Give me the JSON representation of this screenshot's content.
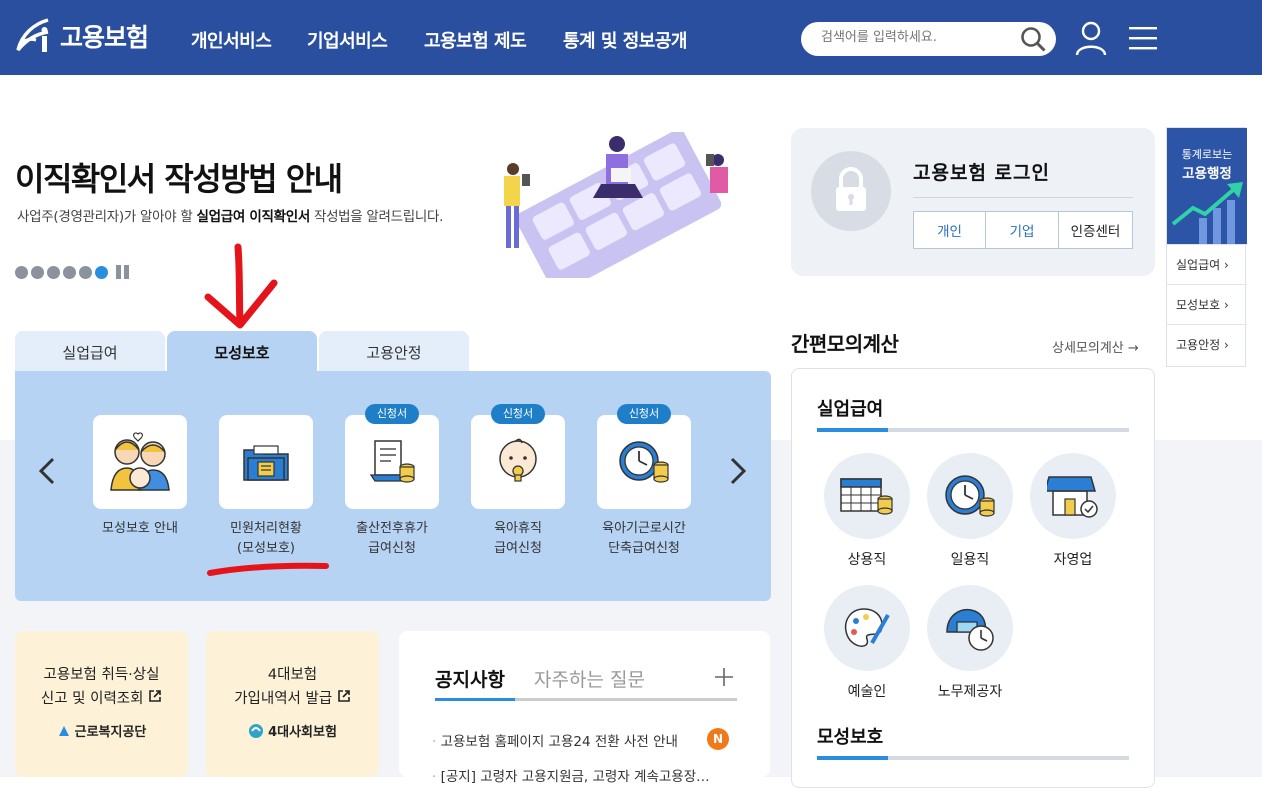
{
  "header": {
    "logo_text": "고용보험",
    "nav": [
      "개인서비스",
      "기업서비스",
      "고용보험 제도",
      "통계 및 정보공개"
    ],
    "search_placeholder": "검색어를 입력하세요."
  },
  "hero": {
    "title": "이직확인서 작성방법 안내",
    "subtitle_pre": "사업주(경영관리자)가 알아야 할 ",
    "subtitle_bold": "실업급여 이직확인서",
    "subtitle_post": " 작성법을 알려드립니다.",
    "slide_count": 6,
    "active_slide": 6
  },
  "tabs": [
    {
      "label": "실업급여",
      "active": false
    },
    {
      "label": "모성보호",
      "active": true
    },
    {
      "label": "고용안정",
      "active": false
    }
  ],
  "services": [
    {
      "line1": "모성보호 안내",
      "line2": "",
      "tag": "",
      "icon": "family-icon"
    },
    {
      "line1": "민원처리현황",
      "line2": "(모성보호)",
      "tag": "",
      "icon": "folder-document-icon"
    },
    {
      "line1": "출산전후휴가",
      "line2": "급여신청",
      "tag": "신청서",
      "icon": "document-coins-icon"
    },
    {
      "line1": "육아휴직",
      "line2": "급여신청",
      "tag": "신청서",
      "icon": "baby-icon"
    },
    {
      "line1": "육아기근로시간",
      "line2": "단축급여신청",
      "tag": "신청서",
      "icon": "clock-coins-icon"
    }
  ],
  "cards": [
    {
      "line1": "고용보험 취득·상실",
      "line2": "신고 및 이력조회",
      "org": "근로복지공단"
    },
    {
      "line1": "4대보험",
      "line2": "가입내역서 발급",
      "org": "4대사회보험"
    }
  ],
  "notice": {
    "tab_active": "공지사항",
    "tab_inactive": "자주하는 질문",
    "items": [
      {
        "text": "고용보험 홈페이지 고용24 전환 사전 안내",
        "badge": "N"
      },
      {
        "text": "[공지] 고령자 고용지원금, 고령자 계속고용장…",
        "badge": ""
      }
    ]
  },
  "login": {
    "title": "고용보험 로그인",
    "buttons": [
      "개인",
      "기업",
      "인증센터"
    ]
  },
  "quick": {
    "top_line1": "통계로보는",
    "top_line2": "고용행정",
    "items": [
      "실업급여",
      "모성보호",
      "고용안정"
    ]
  },
  "calc": {
    "title": "간편모의계산",
    "more": "상세모의계산",
    "section1": "실업급여",
    "items": [
      {
        "label": "상용직",
        "icon": "calendar-coins-icon"
      },
      {
        "label": "일용직",
        "icon": "clock-coins-icon"
      },
      {
        "label": "자영업",
        "icon": "store-icon"
      },
      {
        "label": "예술인",
        "icon": "palette-icon"
      },
      {
        "label": "노무제공자",
        "icon": "helmet-clock-icon"
      }
    ],
    "section2": "모성보호"
  },
  "colors": {
    "header_bg": "#2b4f9f",
    "panel_bg": "#b7d3f4",
    "accent": "#2a8ee0",
    "annotation": "#e5141b"
  }
}
